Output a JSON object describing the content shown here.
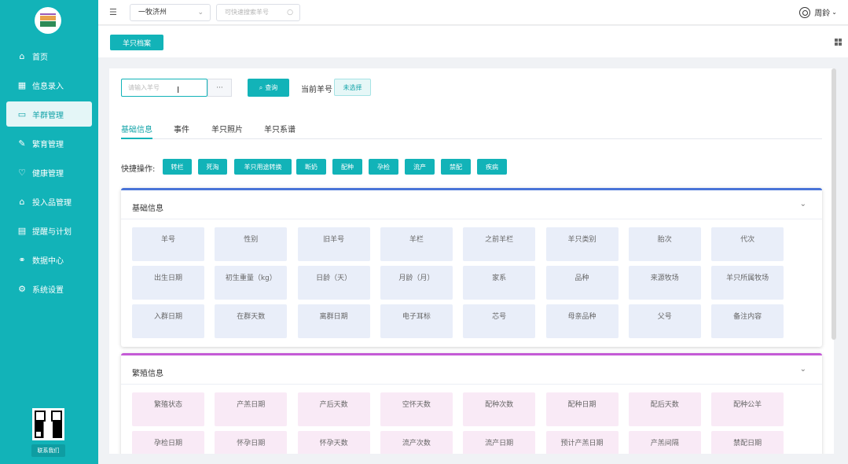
{
  "sidebar": {
    "nav": [
      {
        "label": "首页",
        "icon": "home-icon",
        "glyph": "⌂"
      },
      {
        "label": "信息录入",
        "icon": "grid-icon",
        "glyph": "▦"
      },
      {
        "label": "羊群管理",
        "icon": "flock-icon",
        "glyph": "▭"
      },
      {
        "label": "繁育管理",
        "icon": "breeding-icon",
        "glyph": "✎"
      },
      {
        "label": "健康管理",
        "icon": "health-icon",
        "glyph": "♡"
      },
      {
        "label": "投入品管理",
        "icon": "input-goods-icon",
        "glyph": "⌂"
      },
      {
        "label": "提醒与计划",
        "icon": "reminder-icon",
        "glyph": "▤"
      },
      {
        "label": "数据中心",
        "icon": "data-center-icon",
        "glyph": "⚭"
      },
      {
        "label": "系统设置",
        "icon": "settings-icon",
        "glyph": "⚙"
      }
    ],
    "active_index": 2,
    "contact_label": "联系我们"
  },
  "topbar": {
    "farm_select_value": "一牧济州",
    "search_placeholder": "可快速搜索羊号",
    "user_name": "周鈴"
  },
  "tabstrip": {
    "active_tab": "羊只档案"
  },
  "search": {
    "input_placeholder": "请输入羊号",
    "more_label": "···",
    "query_label": "查询",
    "current_label": "当前羊号",
    "current_value": "未选择"
  },
  "subtabs": [
    "基础信息",
    "事件",
    "羊只照片",
    "羊只系谱"
  ],
  "quick_ops": {
    "label": "快捷操作:",
    "buttons": [
      "转栏",
      "死淘",
      "羊只用途转换",
      "断奶",
      "配种",
      "孕检",
      "流产",
      "禁配",
      "疾病"
    ]
  },
  "basic_info": {
    "title": "基础信息",
    "accent": "#4a74d8",
    "fields": [
      "羊号",
      "性别",
      "旧羊号",
      "羊栏",
      "之前羊栏",
      "羊只类别",
      "胎次",
      "代次",
      "出生日期",
      "初生重量（kg）",
      "日龄（天）",
      "月龄（月）",
      "家系",
      "品种",
      "来源牧场",
      "羊只所属牧场",
      "入群日期",
      "在群天数",
      "离群日期",
      "电子耳标",
      "芯号",
      "母亲品种",
      "父号",
      "备注内容"
    ]
  },
  "breeding_info": {
    "title": "繁殖信息",
    "accent": "#c45bd6",
    "fields": [
      "繁殖状态",
      "产羔日期",
      "产后天数",
      "空怀天数",
      "配种次数",
      "配种日期",
      "配后天数",
      "配种公羊",
      "孕检日期",
      "怀孕日期",
      "怀孕天数",
      "流产次数",
      "流产日期",
      "预计产羔日期",
      "产羔间隔",
      "禁配日期"
    ]
  },
  "colors": {
    "brand": "#12b3b8",
    "basic_cell_bg": "#e9eef9",
    "breeding_cell_bg": "#f9eaf6"
  }
}
